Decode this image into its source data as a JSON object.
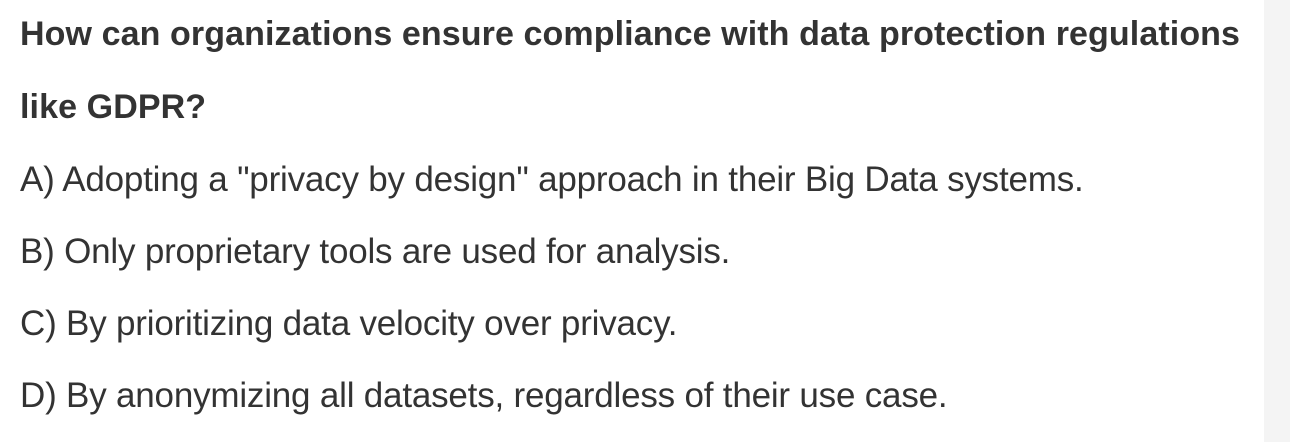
{
  "question": {
    "text": "How can organizations ensure compliance with data protection regulations like GDPR?"
  },
  "options": [
    {
      "label": "A) Adopting a \"privacy by design\" approach in their Big Data systems."
    },
    {
      "label": "B) Only proprietary tools are used for analysis."
    },
    {
      "label": "C) By prioritizing data velocity over privacy."
    },
    {
      "label": "D) By anonymizing all datasets, regardless of their use case."
    }
  ],
  "colors": {
    "text": "#333333",
    "background": "#ffffff",
    "gutter": "#f4f4f4"
  }
}
